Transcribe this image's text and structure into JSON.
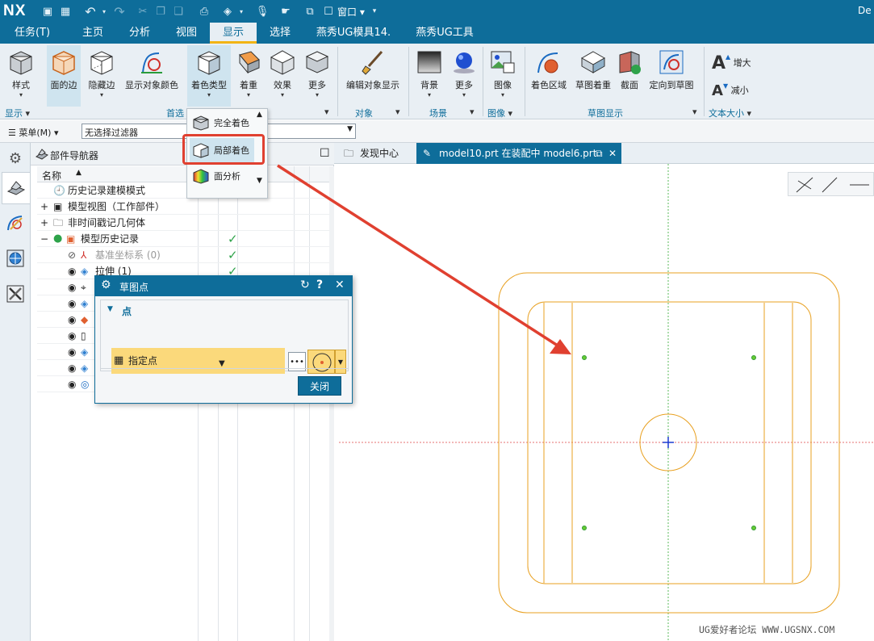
{
  "titlebar": {
    "logo": "NX",
    "window_menu": "窗口",
    "right_text": "De"
  },
  "tabs": [
    "任务(T)",
    "主页",
    "分析",
    "视图",
    "显示",
    "选择",
    "燕秀UG模具14.",
    "燕秀UG工具"
  ],
  "active_tab": "显示",
  "ribbon": {
    "style": "样式",
    "face_edges": "面的边",
    "hidden_edges": "隐藏边",
    "show_object_color": "显示对象颜色",
    "shading_type": "着色类型",
    "emphasis": "着重",
    "effects": "效果",
    "more1": "更多",
    "edit_object_display": "编辑对象显示",
    "background": "背景",
    "more2": "更多",
    "image": "图像",
    "shade_region": "着色区域",
    "sketch_shading": "草图着重",
    "section": "截面",
    "orient_to_sketch": "定向到草图",
    "text_increase": "增大",
    "text_decrease": "减小",
    "groups": {
      "display": "显示",
      "preferences": "首选",
      "object": "对象",
      "scene": "场景",
      "image": "图像",
      "sketch_display": "草图显示",
      "text_size": "文本大小"
    }
  },
  "dropdown": {
    "items": [
      "完全着色",
      "局部着色",
      "面分析"
    ],
    "selected": "局部着色"
  },
  "filterbar": {
    "menu": "菜单(M)",
    "filter": "无选择过滤器"
  },
  "navigator": {
    "title": "部件导航器",
    "column_name": "名称",
    "rows": [
      {
        "label": "历史记录建模模式"
      },
      {
        "label": "模型视图（工作部件）"
      },
      {
        "label": "非时间戳记几何体"
      },
      {
        "label": "模型历史记录"
      },
      {
        "label": "基准坐标系 (0)"
      },
      {
        "label": "拉伸 (1)"
      }
    ]
  },
  "doctabs": {
    "discover": "发现中心",
    "model": "model10.prt 在装配中 model6.prt"
  },
  "dialog": {
    "title": "草图点",
    "section": "点",
    "field": "指定点",
    "close": "关闭"
  },
  "watermark": "UG爱好者论坛 WWW.UGSNX.COM",
  "colors": {
    "brand": "#0e6d9a",
    "accent": "#f2b414",
    "highlight": "#e04030",
    "sketch": "#e8a020"
  }
}
